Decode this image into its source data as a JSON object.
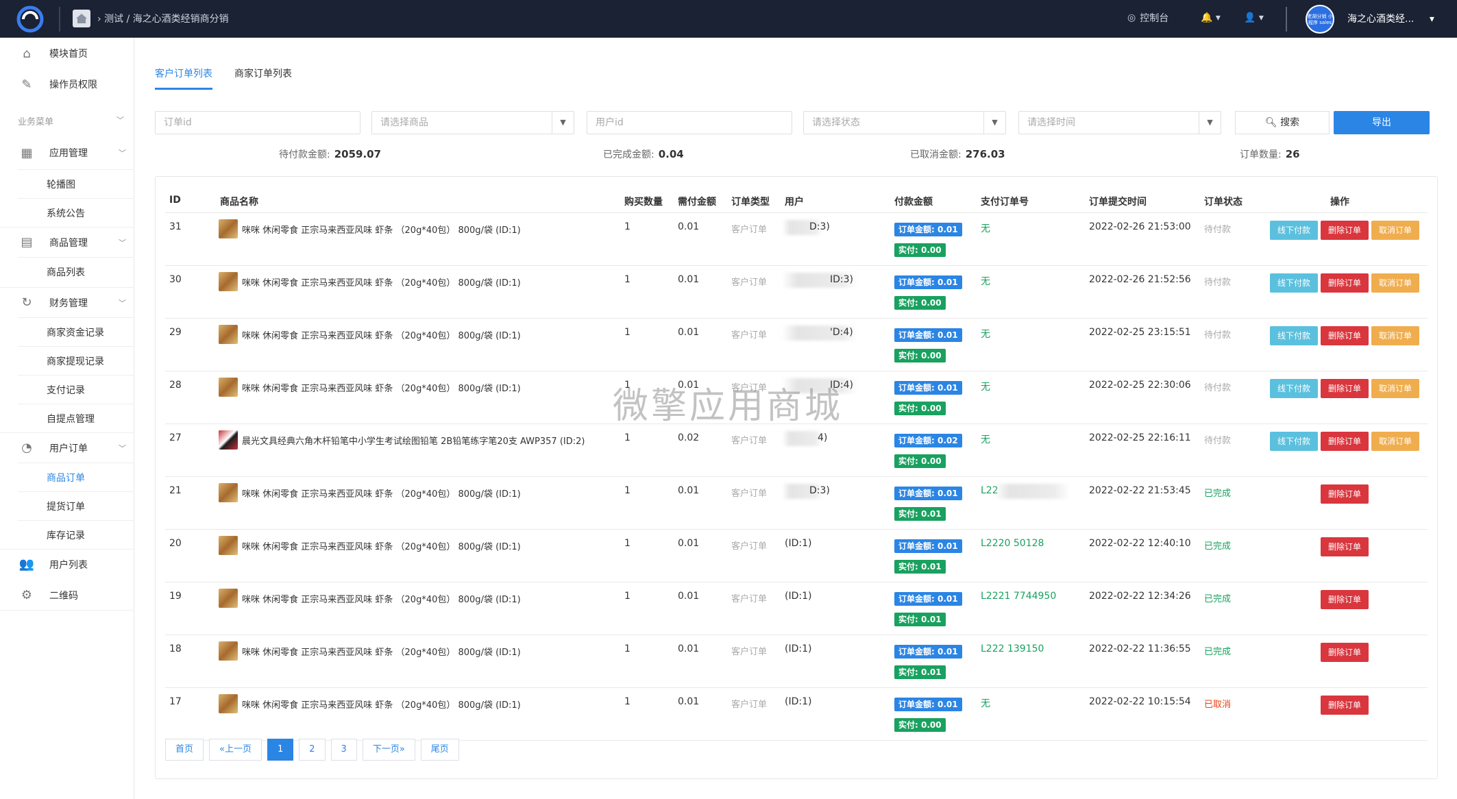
{
  "topbar": {
    "breadcrumb": "测试 / 海之心酒类经销商分销",
    "control_panel": "控制台",
    "avatar_text": "老胡分销 小程序 sales",
    "shop_name": "海之心酒类经..."
  },
  "sidebar": {
    "top_items": [
      "模块首页",
      "操作员权限"
    ],
    "group_label": "业务菜单",
    "app_mgmt": "应用管理",
    "app_subs": [
      "轮播图",
      "系统公告"
    ],
    "goods_mgmt": "商品管理",
    "goods_subs": [
      "商品列表"
    ],
    "finance_mgmt": "财务管理",
    "finance_subs": [
      "商家资金记录",
      "商家提现记录",
      "支付记录",
      "自提点管理"
    ],
    "user_orders": "用户订单",
    "order_subs": [
      "商品订单",
      "提货订单",
      "库存记录"
    ],
    "user_list": "用户列表",
    "qrcode": "二维码"
  },
  "tabs": [
    "客户订单列表",
    "商家订单列表"
  ],
  "filters": {
    "order_id": "订单id",
    "goods": "请选择商品",
    "user_id": "用户id",
    "status": "请选择状态",
    "time": "请选择时间",
    "search": "搜索",
    "export": "导出"
  },
  "stats": {
    "pending_label": "待付款金额:",
    "pending_value": "2059.07",
    "done_label": "已完成金额:",
    "done_value": "0.04",
    "cancel_label": "已取消金额:",
    "cancel_value": "276.03",
    "count_label": "订单数量:",
    "count_value": "26"
  },
  "columns": [
    "ID",
    "商品名称",
    "购买数量",
    "需付金额",
    "订单类型",
    "用户",
    "付款金额",
    "支付订单号",
    "订单提交时间",
    "订单状态",
    "操作"
  ],
  "labels": {
    "order_amount_prefix": "订单金额:",
    "paid_prefix": "实付:",
    "btn_offline": "线下付款",
    "btn_delete": "删除订单",
    "btn_cancel": "取消订单"
  },
  "rows": [
    {
      "id": "31",
      "goods": "咪咪 休闲零食 正宗马来西亚风味 虾条 （20g*40包） 800g/袋 (ID:1)",
      "qty": "1",
      "need": "0.01",
      "type": "客户订单",
      "user": "D:3)",
      "order_amt": "0.01",
      "paid": "0.00",
      "pay_no": "无",
      "time": "2022-02-26 21:53:00",
      "status": "待付款",
      "status_kind": "pending",
      "thumb": "snack",
      "user_blur": true,
      "pay_blur": false
    },
    {
      "id": "30",
      "goods": "咪咪 休闲零食 正宗马来西亚风味 虾条 （20g*40包） 800g/袋 (ID:1)",
      "qty": "1",
      "need": "0.01",
      "type": "客户订单",
      "user": "ID:3)",
      "order_amt": "0.01",
      "paid": "0.00",
      "pay_no": "无",
      "time": "2022-02-26 21:52:56",
      "status": "待付款",
      "status_kind": "pending",
      "thumb": "snack",
      "user_blur": true,
      "pay_blur": false
    },
    {
      "id": "29",
      "goods": "咪咪 休闲零食 正宗马来西亚风味 虾条 （20g*40包） 800g/袋 (ID:1)",
      "qty": "1",
      "need": "0.01",
      "type": "客户订单",
      "user": "'D:4)",
      "order_amt": "0.01",
      "paid": "0.00",
      "pay_no": "无",
      "time": "2022-02-25 23:15:51",
      "status": "待付款",
      "status_kind": "pending",
      "thumb": "snack",
      "user_blur": true,
      "pay_blur": false
    },
    {
      "id": "28",
      "goods": "咪咪 休闲零食 正宗马来西亚风味 虾条 （20g*40包） 800g/袋 (ID:1)",
      "qty": "1",
      "need": "0.01",
      "type": "客户订单",
      "user": "ID:4)",
      "order_amt": "0.01",
      "paid": "0.00",
      "pay_no": "无",
      "time": "2022-02-25 22:30:06",
      "status": "待付款",
      "status_kind": "pending",
      "thumb": "snack",
      "user_blur": true,
      "pay_blur": false
    },
    {
      "id": "27",
      "goods": "晨光文具经典六角木杆铅笔中小学生考试绘图铅笔 2B铅笔练字笔20支 AWP357 (ID:2)",
      "qty": "1",
      "need": "0.02",
      "type": "客户订单",
      "user": "4)",
      "order_amt": "0.02",
      "paid": "0.00",
      "pay_no": "无",
      "time": "2022-02-25 22:16:11",
      "status": "待付款",
      "status_kind": "pending",
      "thumb": "pencil",
      "user_blur": true,
      "pay_blur": false
    },
    {
      "id": "21",
      "goods": "咪咪 休闲零食 正宗马来西亚风味 虾条 （20g*40包） 800g/袋 (ID:1)",
      "qty": "1",
      "need": "0.01",
      "type": "客户订单",
      "user": "D:3)",
      "order_amt": "0.01",
      "paid": "0.01",
      "pay_no": "L22",
      "time": "2022-02-22 21:53:45",
      "status": "已完成",
      "status_kind": "done",
      "thumb": "snack",
      "user_blur": true,
      "pay_blur": true
    },
    {
      "id": "20",
      "goods": "咪咪 休闲零食 正宗马来西亚风味 虾条 （20g*40包） 800g/袋 (ID:1)",
      "qty": "1",
      "need": "0.01",
      "type": "客户订单",
      "user": "(ID:1)",
      "order_amt": "0.01",
      "paid": "0.01",
      "pay_no": "L2220      50128",
      "time": "2022-02-22 12:40:10",
      "status": "已完成",
      "status_kind": "done",
      "thumb": "snack",
      "user_blur": false,
      "pay_blur": false
    },
    {
      "id": "19",
      "goods": "咪咪 休闲零食 正宗马来西亚风味 虾条 （20g*40包） 800g/袋 (ID:1)",
      "qty": "1",
      "need": "0.01",
      "type": "客户订单",
      "user": "(ID:1)",
      "order_amt": "0.01",
      "paid": "0.01",
      "pay_no": "L2221      7744950",
      "time": "2022-02-22 12:34:26",
      "status": "已完成",
      "status_kind": "done",
      "thumb": "snack",
      "user_blur": false,
      "pay_blur": false
    },
    {
      "id": "18",
      "goods": "咪咪 休闲零食 正宗马来西亚风味 虾条 （20g*40包） 800g/袋 (ID:1)",
      "qty": "1",
      "need": "0.01",
      "type": "客户订单",
      "user": "(ID:1)",
      "order_amt": "0.01",
      "paid": "0.01",
      "pay_no": "L222        139150",
      "time": "2022-02-22 11:36:55",
      "status": "已完成",
      "status_kind": "done",
      "thumb": "snack",
      "user_blur": false,
      "pay_blur": false
    },
    {
      "id": "17",
      "goods": "咪咪 休闲零食 正宗马来西亚风味 虾条 （20g*40包） 800g/袋 (ID:1)",
      "qty": "1",
      "need": "0.01",
      "type": "客户订单",
      "user": "(ID:1)",
      "order_amt": "0.01",
      "paid": "0.00",
      "pay_no": "无",
      "time": "2022-02-22 10:15:54",
      "status": "已取消",
      "status_kind": "cancel",
      "thumb": "snack",
      "user_blur": false,
      "pay_blur": false
    }
  ],
  "pager": [
    "首页",
    "«上一页",
    "1",
    "2",
    "3",
    "下一页»",
    "尾页"
  ],
  "watermark": "微擎应用商城"
}
